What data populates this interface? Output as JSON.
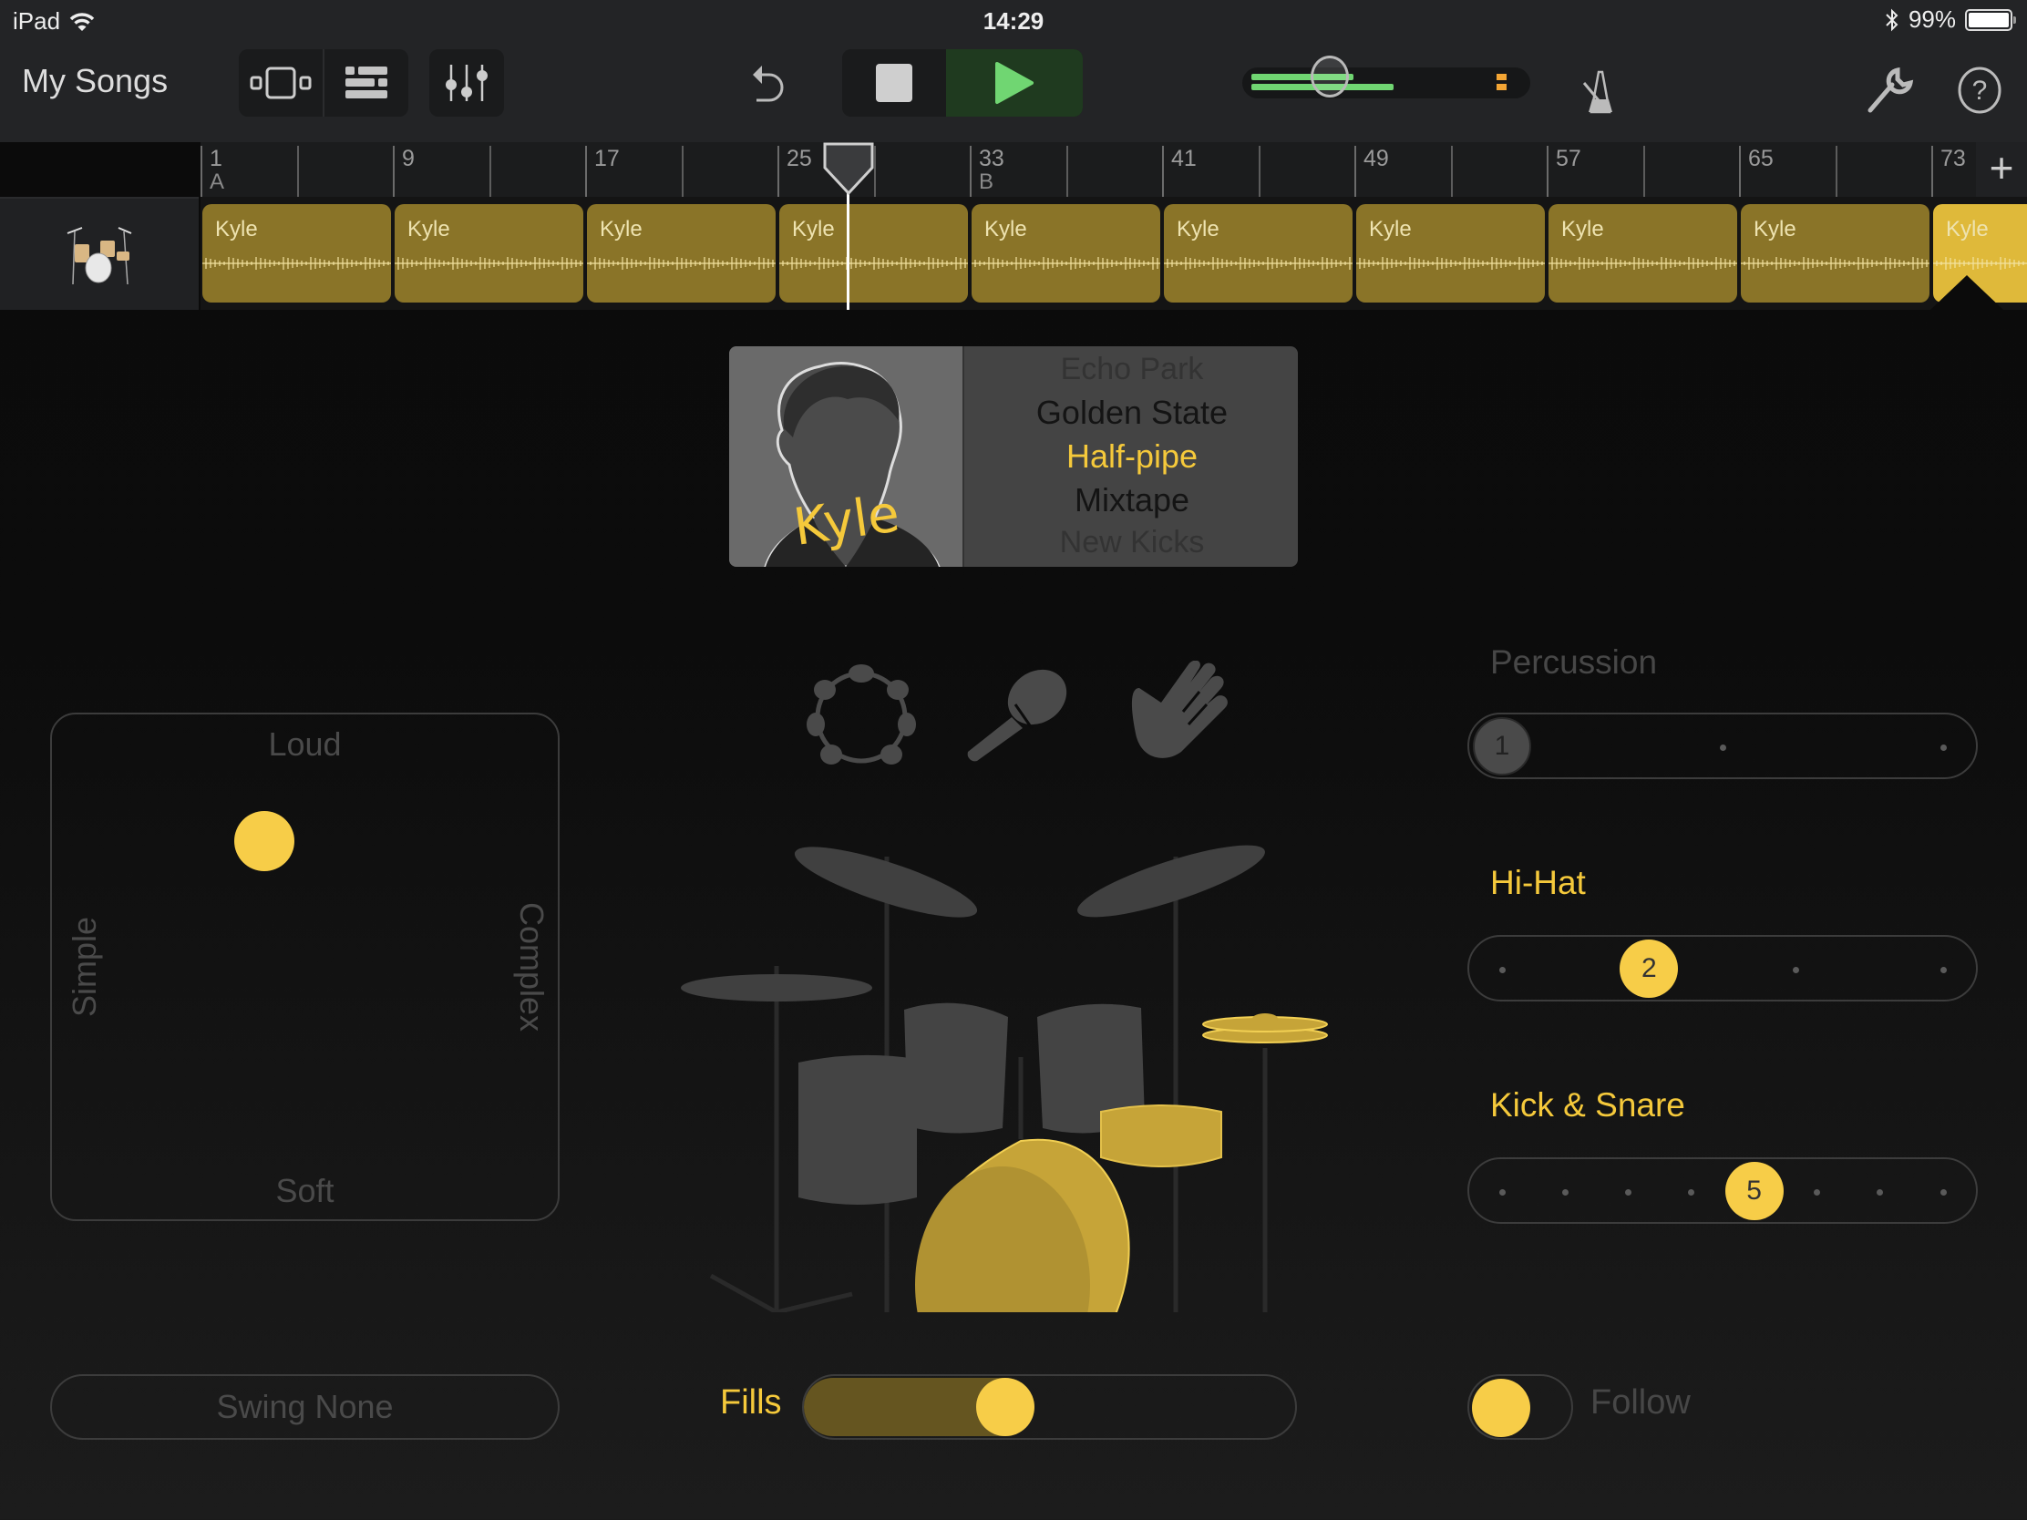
{
  "status_bar": {
    "device": "iPad",
    "time": "14:29",
    "battery_percent": "99%",
    "icons": [
      "wifi-icon",
      "bluetooth-icon",
      "battery-icon"
    ]
  },
  "toolbar": {
    "my_songs_label": "My Songs",
    "buttons": [
      "browser-view-icon",
      "tracks-view-icon",
      "mixer-icon",
      "undo-icon",
      "stop-icon",
      "play-icon",
      "metronome-icon",
      "settings-wrench-icon",
      "help-icon"
    ],
    "master_volume": {
      "level": 0.25,
      "meter_left": 0.43,
      "meter_right": 0.6
    },
    "colors": {
      "play_bg": "#1f3a1f",
      "play_icon": "#70d672",
      "meter": "#70d672",
      "clip": "#f3a534"
    }
  },
  "ruler": {
    "bars": [
      "1",
      "9",
      "17",
      "25",
      "33",
      "41",
      "49",
      "57",
      "65",
      "73"
    ],
    "sections": [
      {
        "bar": "1",
        "label": "A"
      },
      {
        "bar": "33",
        "label": "B"
      }
    ],
    "playhead_bar": 29,
    "add_label": "+"
  },
  "track": {
    "instrument_icon": "drum-kit-icon",
    "regions": [
      {
        "name": "Kyle",
        "selected": false
      },
      {
        "name": "Kyle",
        "selected": false
      },
      {
        "name": "Kyle",
        "selected": false
      },
      {
        "name": "Kyle",
        "selected": false
      },
      {
        "name": "Kyle",
        "selected": false
      },
      {
        "name": "Kyle",
        "selected": false
      },
      {
        "name": "Kyle",
        "selected": false
      },
      {
        "name": "Kyle",
        "selected": false
      },
      {
        "name": "Kyle",
        "selected": false
      },
      {
        "name": "Kyle",
        "selected": true
      }
    ],
    "region_color": "#8a7428",
    "selected_region_color": "#dfb93a"
  },
  "drummer": {
    "name": "Kyle",
    "styles": [
      {
        "label": "Echo Park",
        "state": "far"
      },
      {
        "label": "Golden State",
        "state": "near"
      },
      {
        "label": "Half-pipe",
        "state": "selected"
      },
      {
        "label": "Mixtape",
        "state": "near"
      },
      {
        "label": "New Kicks",
        "state": "far"
      }
    ]
  },
  "xy_pad": {
    "top_label": "Loud",
    "bottom_label": "Soft",
    "left_label": "Simple",
    "right_label": "Complex",
    "complexity": 0.42,
    "loudness": 0.75
  },
  "percussion_instruments": [
    "tambourine-icon",
    "maraca-icon",
    "hand-clap-icon"
  ],
  "sliders": [
    {
      "id": "percussion",
      "label": "Percussion",
      "active": false,
      "steps": 3,
      "value": 1,
      "value_label": "1"
    },
    {
      "id": "hihat",
      "label": "Hi-Hat",
      "active": true,
      "steps": 4,
      "value": 2,
      "value_label": "2"
    },
    {
      "id": "kick-snare",
      "label": "Kick & Snare",
      "active": true,
      "steps": 8,
      "value": 5,
      "value_label": "5"
    }
  ],
  "bottom": {
    "swing_label": "Swing None",
    "fills_label": "Fills",
    "fills_value": 0.35,
    "follow_label": "Follow",
    "follow_on": false
  },
  "accent_color": "#f7cd48"
}
